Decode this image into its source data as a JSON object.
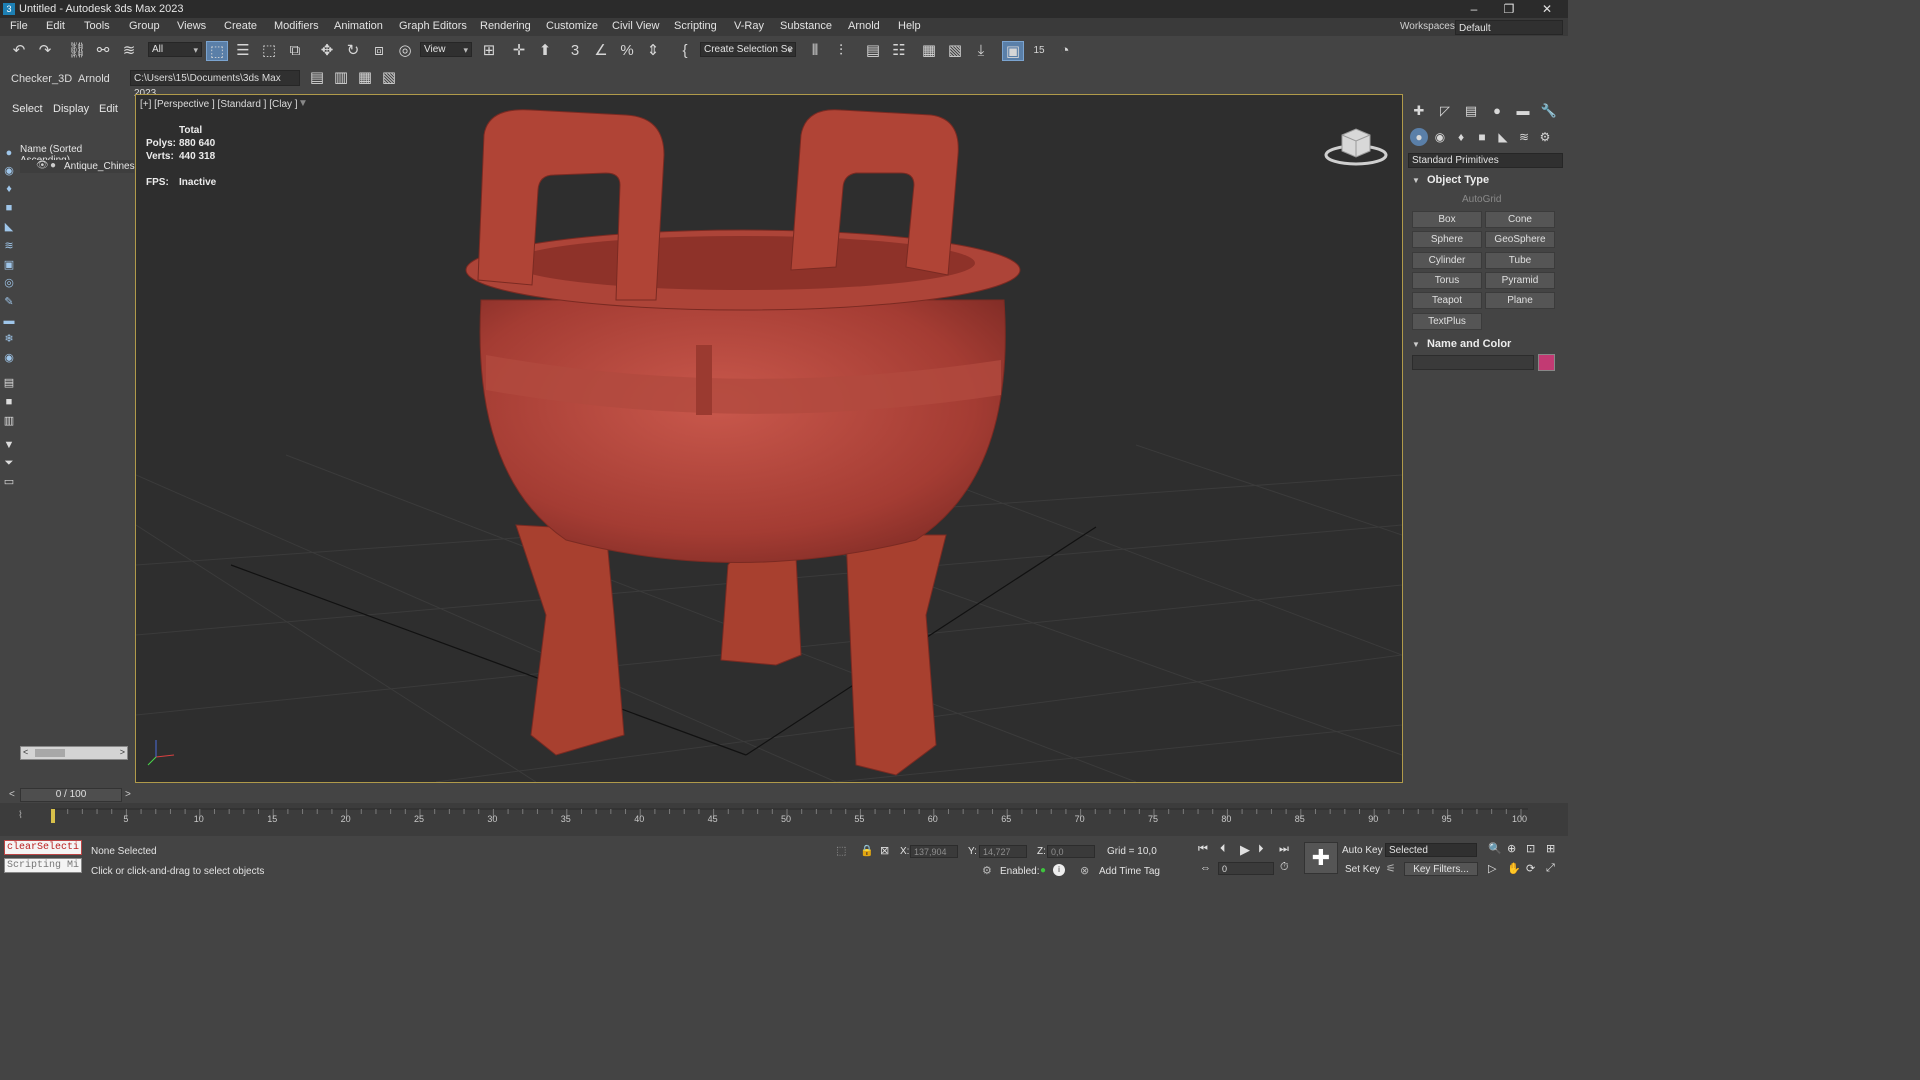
{
  "window": {
    "title": "Untitled - Autodesk 3ds Max 2023",
    "app_icon": "3"
  },
  "menu": [
    "File",
    "Edit",
    "Tools",
    "Group",
    "Views",
    "Create",
    "Modifiers",
    "Animation",
    "Graph Editors",
    "Rendering",
    "Customize",
    "Civil View",
    "Scripting",
    "V-Ray",
    "Substance",
    "Arnold",
    "Help"
  ],
  "workspaces": {
    "label": "Workspaces:",
    "value": "Default"
  },
  "toolbar": {
    "selection_filter": "All",
    "ref_coord": "View",
    "named_selection": "Create Selection Se",
    "frame_badge": "15"
  },
  "ribbon2": {
    "tabs": [
      "Checker_3D",
      "Arnold"
    ],
    "project_path": "C:\\Users\\15\\Documents\\3ds Max 2023"
  },
  "explorer": {
    "tabs": [
      "Select",
      "Display",
      "Edit"
    ],
    "column_header": "Name (Sorted Ascending)",
    "items": [
      {
        "name": "Antique_Chinese"
      }
    ]
  },
  "viewport": {
    "label": "[+] [Perspective ] [Standard ] [Clay ]",
    "stats": {
      "total_label": "Total",
      "polys_label": "Polys:",
      "polys": "880 640",
      "verts_label": "Verts:",
      "verts": "440 318",
      "fps_label": "FPS:",
      "fps": "Inactive"
    },
    "object_color": "#b5463c"
  },
  "command_panel": {
    "category": "Standard Primitives",
    "object_type_title": "Object Type",
    "autogrid_label": "AutoGrid",
    "primitives": [
      "Box",
      "Cone",
      "Sphere",
      "GeoSphere",
      "Cylinder",
      "Tube",
      "Torus",
      "Pyramid",
      "Teapot",
      "Plane",
      "TextPlus"
    ],
    "name_color_title": "Name and Color",
    "swatch_color": "#c23a73"
  },
  "timeline": {
    "slider_text": "0 / 100",
    "ticks": [
      "5",
      "10",
      "15",
      "20",
      "25",
      "30",
      "35",
      "40",
      "45",
      "50",
      "55",
      "60",
      "65",
      "70",
      "75",
      "80",
      "85",
      "90",
      "95",
      "100"
    ]
  },
  "status": {
    "maxscript_input": "clearSelecti",
    "maxscript_listener": "Scripting Mi",
    "selection": "None Selected",
    "prompt": "Click or click-and-drag to select objects",
    "x_label": "X:",
    "x_value": "137,904",
    "y_label": "Y:",
    "y_value": "14,727",
    "z_label": "Z:",
    "z_value": "0,0",
    "grid": "Grid = 10,0",
    "enabled_label": "Enabled:",
    "add_time_tag": "Add Time Tag",
    "auto_key": "Auto Key",
    "set_key": "Set Key",
    "key_mode": "Selected",
    "key_filters": "Key Filters...",
    "current_frame": "0"
  }
}
